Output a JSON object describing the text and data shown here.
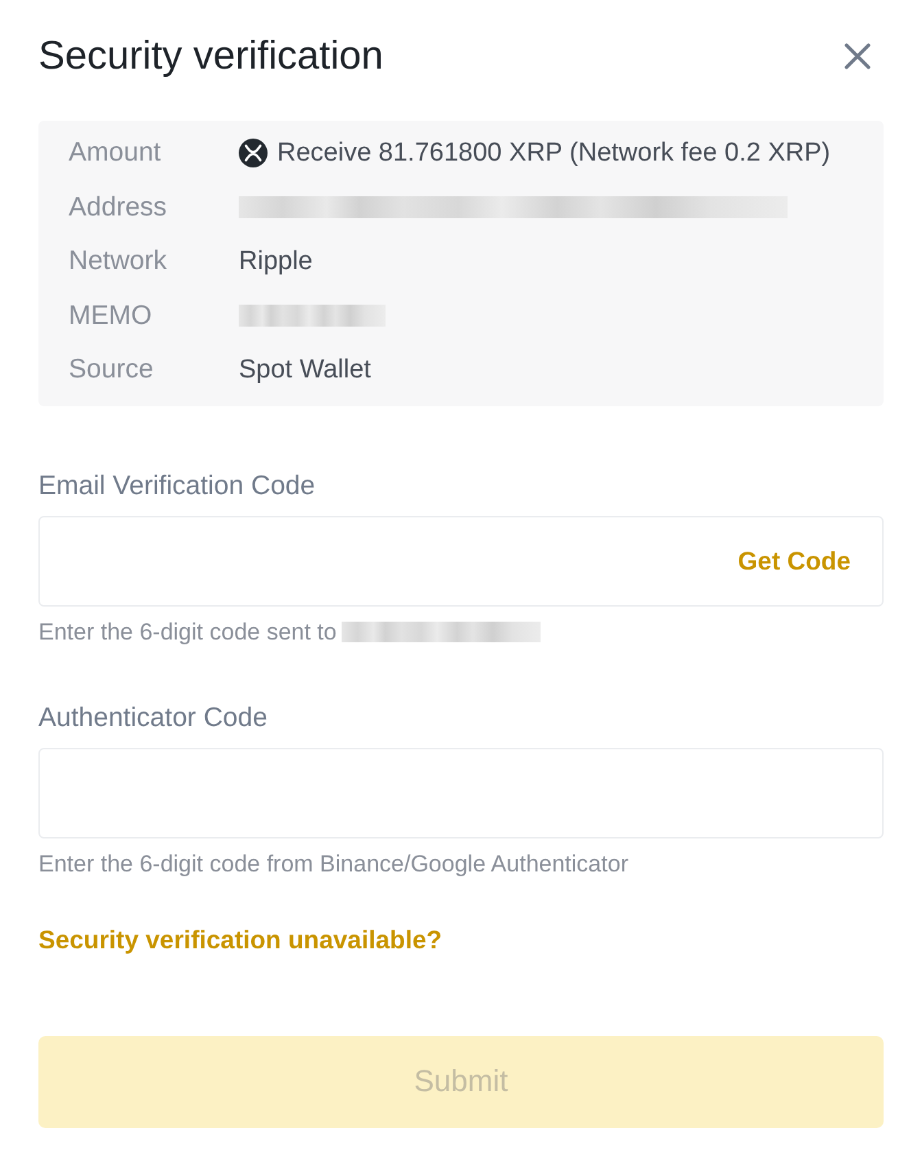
{
  "dialog": {
    "title": "Security verification"
  },
  "details": [
    {
      "label": "Amount",
      "kind": "coin_amount",
      "value": "Receive 81.761800 XRP (Network fee 0.2 XRP)"
    },
    {
      "label": "Address",
      "kind": "redacted"
    },
    {
      "label": "Network",
      "kind": "text",
      "value": "Ripple"
    },
    {
      "label": "MEMO",
      "kind": "redacted"
    },
    {
      "label": "Source",
      "kind": "text",
      "value": "Spot Wallet"
    }
  ],
  "fields": [
    {
      "label": "Email Verification Code",
      "action": "Get Code",
      "hint": "Enter the 6-digit code sent to",
      "hint_redacted": true
    },
    {
      "label": "Authenticator Code",
      "hint": "Enter the 6-digit code from Binance/Google Authenticator",
      "hint_redacted": false
    }
  ],
  "help_link": "Security verification unavailable?",
  "submit": {
    "label": "Submit",
    "disabled": true
  }
}
